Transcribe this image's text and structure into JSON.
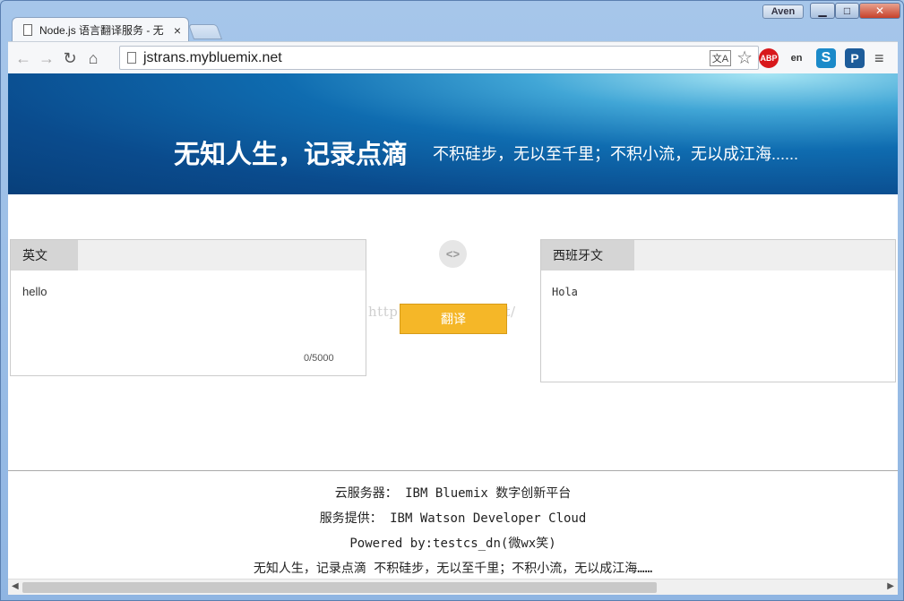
{
  "browser": {
    "tab_title": "Node.js 语言翻译服务 - 无",
    "url": "jstrans.mybluemix.net",
    "user_name": "Aven",
    "buttons": {
      "back": "←",
      "forward": "→",
      "reload": "↻",
      "home": "⌂",
      "menu": "≡",
      "close_tab": "×",
      "star": "☆",
      "translate": "文A"
    },
    "extensions": {
      "abp": "ABP",
      "en": "en",
      "s": "S",
      "p": "P"
    },
    "window_controls": {
      "minimize": "▁",
      "maximize": "□",
      "close": "✕"
    }
  },
  "banner": {
    "title": "无知人生，记录点滴",
    "subtitle": "不积硅步，无以至千里；不积小流，无以成江海......"
  },
  "translator": {
    "source_lang": "英文",
    "source_text": "hello",
    "char_count": "0/5000",
    "target_lang": "西班牙文",
    "result_text": "Hola",
    "swap_label": "<>",
    "translate_button": "翻译",
    "watermark": "http://blog.csdn.net/"
  },
  "footer": {
    "line1": "云服务器： IBM Bluemix 数字创新平台",
    "line2": "服务提供： IBM Watson Developer Cloud",
    "line3": "Powered by:testcs_dn(微wx笑)",
    "line4": "无知人生，记录点滴 不积硅步，无以至千里；不积小流，无以成江海……"
  },
  "colors": {
    "banner_dark": "#083f7a",
    "banner_light": "#a9e6f4",
    "translate_button": "#f5b728"
  }
}
